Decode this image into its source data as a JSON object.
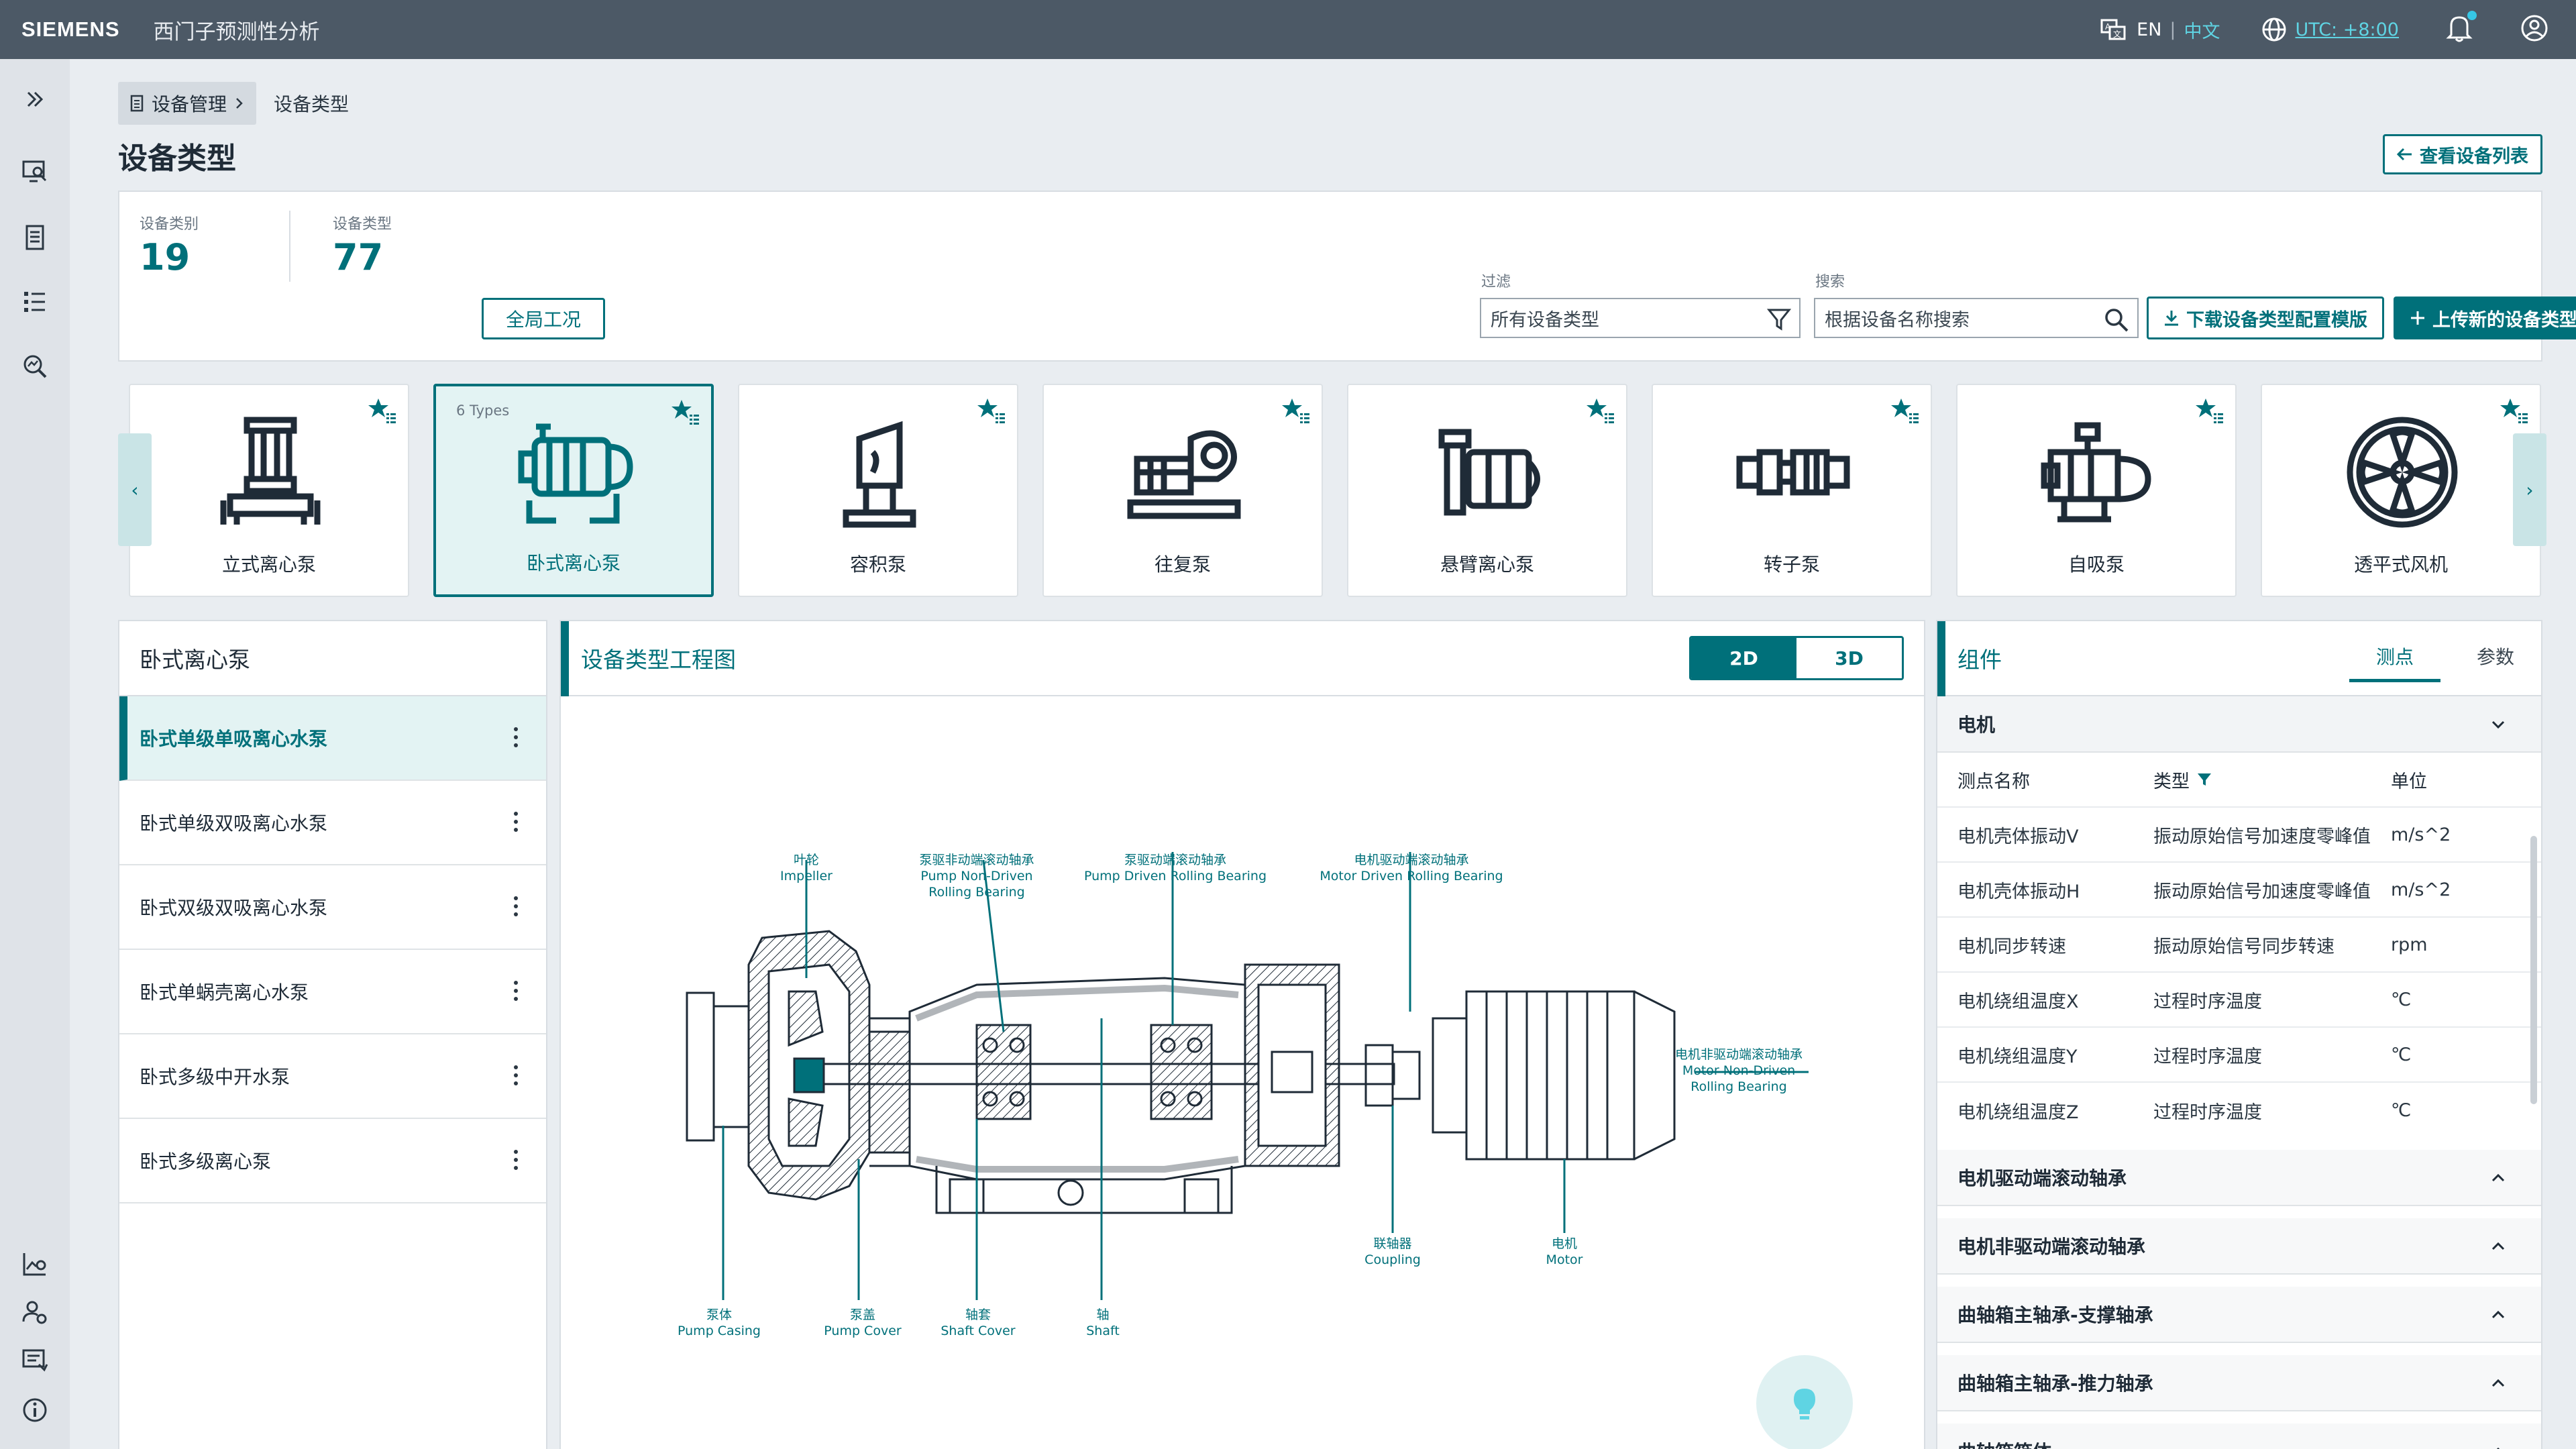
{
  "topbar": {
    "brand": "SIEMENS",
    "app_title": "西门子预测性分析",
    "lang_en": "EN",
    "lang_sep": "|",
    "lang_zh": "中文",
    "timezone": "UTC: +8:00"
  },
  "breadcrumb": {
    "root": "设备管理",
    "current": "设备类型"
  },
  "page": {
    "title": "设备类型",
    "view_list_button": "查看设备列表"
  },
  "stats": {
    "category_label": "设备类别",
    "category_value": "19",
    "type_label": "设备类型",
    "type_value": "77",
    "global_button": "全局工况"
  },
  "filter": {
    "label": "过滤",
    "value": "所有设备类型"
  },
  "search": {
    "label": "搜索",
    "placeholder": "根据设备名称搜索"
  },
  "actions": {
    "download": "下载设备类型配置模版",
    "upload": "上传新的设备类型"
  },
  "cards": [
    {
      "name": "立式离心泵",
      "icon": "vertical-pump-icon"
    },
    {
      "name": "卧式离心泵",
      "icon": "horizontal-pump-icon",
      "count": "6 Types",
      "selected": true
    },
    {
      "name": "容积泵",
      "icon": "displacement-pump-icon"
    },
    {
      "name": "往复泵",
      "icon": "reciprocating-pump-icon"
    },
    {
      "name": "悬臂离心泵",
      "icon": "cantilever-pump-icon"
    },
    {
      "name": "转子泵",
      "icon": "rotor-pump-icon"
    },
    {
      "name": "自吸泵",
      "icon": "self-priming-pump-icon"
    },
    {
      "name": "透平式风机",
      "icon": "turbine-fan-icon"
    }
  ],
  "left_panel": {
    "title": "卧式离心泵",
    "items": [
      "卧式单级单吸离心水泵",
      "卧式单级双吸离心水泵",
      "卧式双级双吸离心水泵",
      "卧式单蜗壳离心水泵",
      "卧式多级中开水泵",
      "卧式多级离心泵"
    ]
  },
  "drawing": {
    "title": "设备类型工程图",
    "mode_2d": "2D",
    "mode_3d": "3D",
    "labels": {
      "impeller_cn": "叶轮",
      "impeller_en": "Impeller",
      "pndb_cn": "泵驱非动端滚动轴承",
      "pndb_en1": "Pump Non-Driven",
      "pndb_en2": "Rolling Bearing",
      "pdb_cn": "泵驱动端滚动轴承",
      "pdb_en": "Pump Driven Rolling Bearing",
      "mdb_cn": "电机驱动端滚动轴承",
      "mdb_en": "Motor Driven Rolling Bearing",
      "mndb_cn": "电机非驱动端滚动轴承",
      "mndb_en1": "Motor Non-Driven",
      "mndb_en2": "Rolling Bearing",
      "coupling_cn": "联轴器",
      "coupling_en": "Coupling",
      "motor_cn": "电机",
      "motor_en": "Motor",
      "casing_cn": "泵体",
      "casing_en": "Pump Casing",
      "cover_cn": "泵盖",
      "cover_en": "Pump Cover",
      "sleeve_cn": "轴套",
      "sleeve_en": "Shaft Cover",
      "shaft_cn": "轴",
      "shaft_en": "Shaft"
    }
  },
  "components": {
    "title": "组件",
    "tab_points": "测点",
    "tab_params": "参数",
    "motor_group": "电机",
    "col_name": "测点名称",
    "col_type": "类型",
    "col_unit": "单位",
    "rows": [
      {
        "name": "电机壳体振动V",
        "type": "振动原始信号加速度零峰值",
        "unit": "m/s^2"
      },
      {
        "name": "电机壳体振动H",
        "type": "振动原始信号加速度零峰值",
        "unit": "m/s^2"
      },
      {
        "name": "电机同步转速",
        "type": "振动原始信号同步转速",
        "unit": "rpm"
      },
      {
        "name": "电机绕组温度X",
        "type": "过程时序温度",
        "unit": "℃"
      },
      {
        "name": "电机绕组温度Y",
        "type": "过程时序温度",
        "unit": "℃"
      },
      {
        "name": "电机绕组温度Z",
        "type": "过程时序温度",
        "unit": "℃"
      }
    ],
    "groups": [
      "电机驱动端滚动轴承",
      "电机非驱动端滚动轴承",
      "曲轴箱主轴承-支撑轴承",
      "曲轴箱主轴承-推力轴承",
      "曲轴箱箱体"
    ]
  }
}
